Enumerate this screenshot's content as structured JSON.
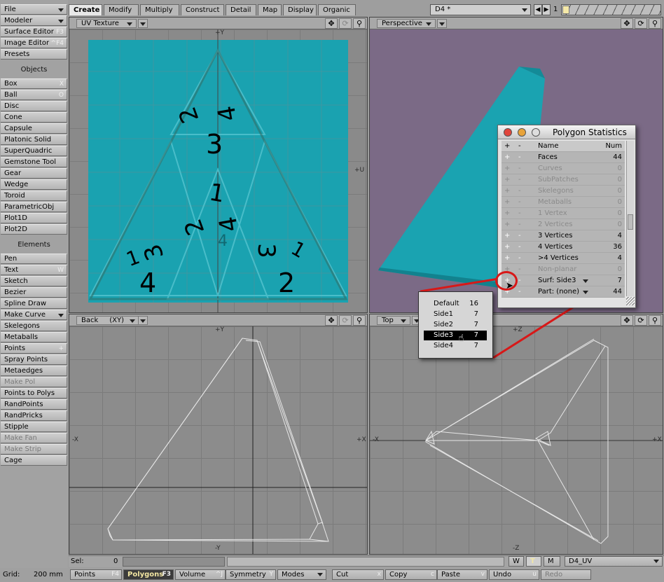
{
  "sidebar": {
    "top": [
      {
        "label": "File",
        "dropdown": true
      },
      {
        "label": "Modeler",
        "dropdown": true
      },
      {
        "label": "Surface Editor",
        "key": "F3"
      },
      {
        "label": "Image Editor",
        "key": "^F4"
      },
      {
        "label": "Presets"
      }
    ],
    "objects_header": "Objects",
    "objects": [
      {
        "label": "Box",
        "key": "X"
      },
      {
        "label": "Ball",
        "key": "O"
      },
      {
        "label": "Disc"
      },
      {
        "label": "Cone"
      },
      {
        "label": "Capsule"
      },
      {
        "label": "Platonic Solid"
      },
      {
        "label": "SuperQuadric"
      },
      {
        "label": "Gemstone Tool"
      },
      {
        "label": "Gear"
      },
      {
        "label": "Wedge"
      },
      {
        "label": "Toroid"
      },
      {
        "label": "ParametricObj"
      },
      {
        "label": "Plot1D"
      },
      {
        "label": "Plot2D"
      }
    ],
    "elements_header": "Elements",
    "elements": [
      {
        "label": "Pen"
      },
      {
        "label": "Text",
        "key": "W"
      },
      {
        "label": "Sketch"
      },
      {
        "label": "Bezier"
      },
      {
        "label": "Spline Draw"
      },
      {
        "label": "Make Curve",
        "dropdown": true
      },
      {
        "label": "Skelegons"
      },
      {
        "label": "Metaballs"
      },
      {
        "label": "Points",
        "key": "+"
      },
      {
        "label": "Spray Points"
      },
      {
        "label": "Metaedges"
      },
      {
        "label": "Make Pol",
        "disabled": true
      },
      {
        "label": "Points to Polys"
      },
      {
        "label": "RandPoints"
      },
      {
        "label": "RandPricks"
      },
      {
        "label": "Stipple"
      },
      {
        "label": "Make Fan",
        "disabled": true
      },
      {
        "label": "Make Strip",
        "disabled": true
      },
      {
        "label": "Cage"
      }
    ]
  },
  "tabs": [
    "Create",
    "Modify",
    "Multiply",
    "Construct",
    "Detail",
    "Map",
    "Display",
    "Organic"
  ],
  "active_tab": "Create",
  "topright": {
    "object": "D4 *",
    "layer_number": "1"
  },
  "viewports": {
    "uv": {
      "label": "UV Texture",
      "axis_top": "+Y",
      "axis_right": "+U"
    },
    "persp": {
      "label": "Perspective"
    },
    "back": {
      "label": "Back",
      "mode": "(XY)",
      "axis_top": "+Y",
      "axis_bottom": "-Y",
      "axis_left": "-X",
      "axis_right": "+X"
    },
    "top": {
      "label": "Top",
      "axis_top": "+Z",
      "axis_bottom": "-Z",
      "axis_left": "-X",
      "axis_right": "+X"
    }
  },
  "uv_numbers": [
    "2",
    "4",
    "3",
    "1",
    "2",
    "4",
    "4",
    "3",
    "1",
    "4",
    "3",
    "1",
    "2"
  ],
  "poly_stats": {
    "title": "Polygon Statistics",
    "header": {
      "plus": "+",
      "minus": "-",
      "name": "Name",
      "num": "Num"
    },
    "rows": [
      {
        "name": "Faces",
        "num": "44",
        "enabled": true
      },
      {
        "name": "Curves",
        "num": "0",
        "enabled": false
      },
      {
        "name": "SubPatches",
        "num": "0",
        "enabled": false
      },
      {
        "name": "Skelegons",
        "num": "0",
        "enabled": false
      },
      {
        "name": "Metaballs",
        "num": "0",
        "enabled": false
      },
      {
        "name": "1 Vertex",
        "num": "0",
        "enabled": false
      },
      {
        "name": "2 Vertices",
        "num": "0",
        "enabled": false
      },
      {
        "name": "3 Vertices",
        "num": "4",
        "enabled": true
      },
      {
        "name": "4 Vertices",
        "num": "36",
        "enabled": true
      },
      {
        "name": ">4 Vertices",
        "num": "4",
        "enabled": true
      },
      {
        "name": "Non-planar",
        "num": "0",
        "enabled": false
      },
      {
        "name": "Surf: Side3",
        "num": "7",
        "enabled": true,
        "dropdown": true
      },
      {
        "name": "Part: (none)",
        "num": "44",
        "enabled": true,
        "dropdown": true
      }
    ]
  },
  "surface_popup": [
    {
      "name": "Default",
      "num": "16"
    },
    {
      "name": "Side1",
      "num": "7"
    },
    {
      "name": "Side2",
      "num": "7"
    },
    {
      "name": "Side3",
      "num": "7",
      "selected": true
    },
    {
      "name": "Side4",
      "num": "7"
    }
  ],
  "status": {
    "sel_label": "Sel:",
    "sel_value": "0",
    "w": "W",
    "t": "T",
    "m": "M",
    "uvmap": "D4_UV"
  },
  "bottom": {
    "grid_label": "Grid:",
    "grid_value": "200 mm",
    "buttons": [
      {
        "label": "Points",
        "key": "F4"
      },
      {
        "label": "Polygons",
        "key": "F3",
        "active": true
      },
      {
        "label": "Volume",
        "key": "^J"
      },
      {
        "label": "Symmetry",
        "key": "Y"
      },
      {
        "label": "Modes",
        "dropdown": true
      },
      {
        "label": "Cut",
        "key": "x"
      },
      {
        "label": "Copy",
        "key": "c"
      },
      {
        "label": "Paste",
        "key": "v"
      },
      {
        "label": "Undo",
        "key": "u"
      },
      {
        "label": "Redo",
        "disabled": true
      }
    ]
  },
  "colors": {
    "teal": "#1aa2b0",
    "persp_bg": "#7b6a86",
    "annotation": "#d81818"
  }
}
